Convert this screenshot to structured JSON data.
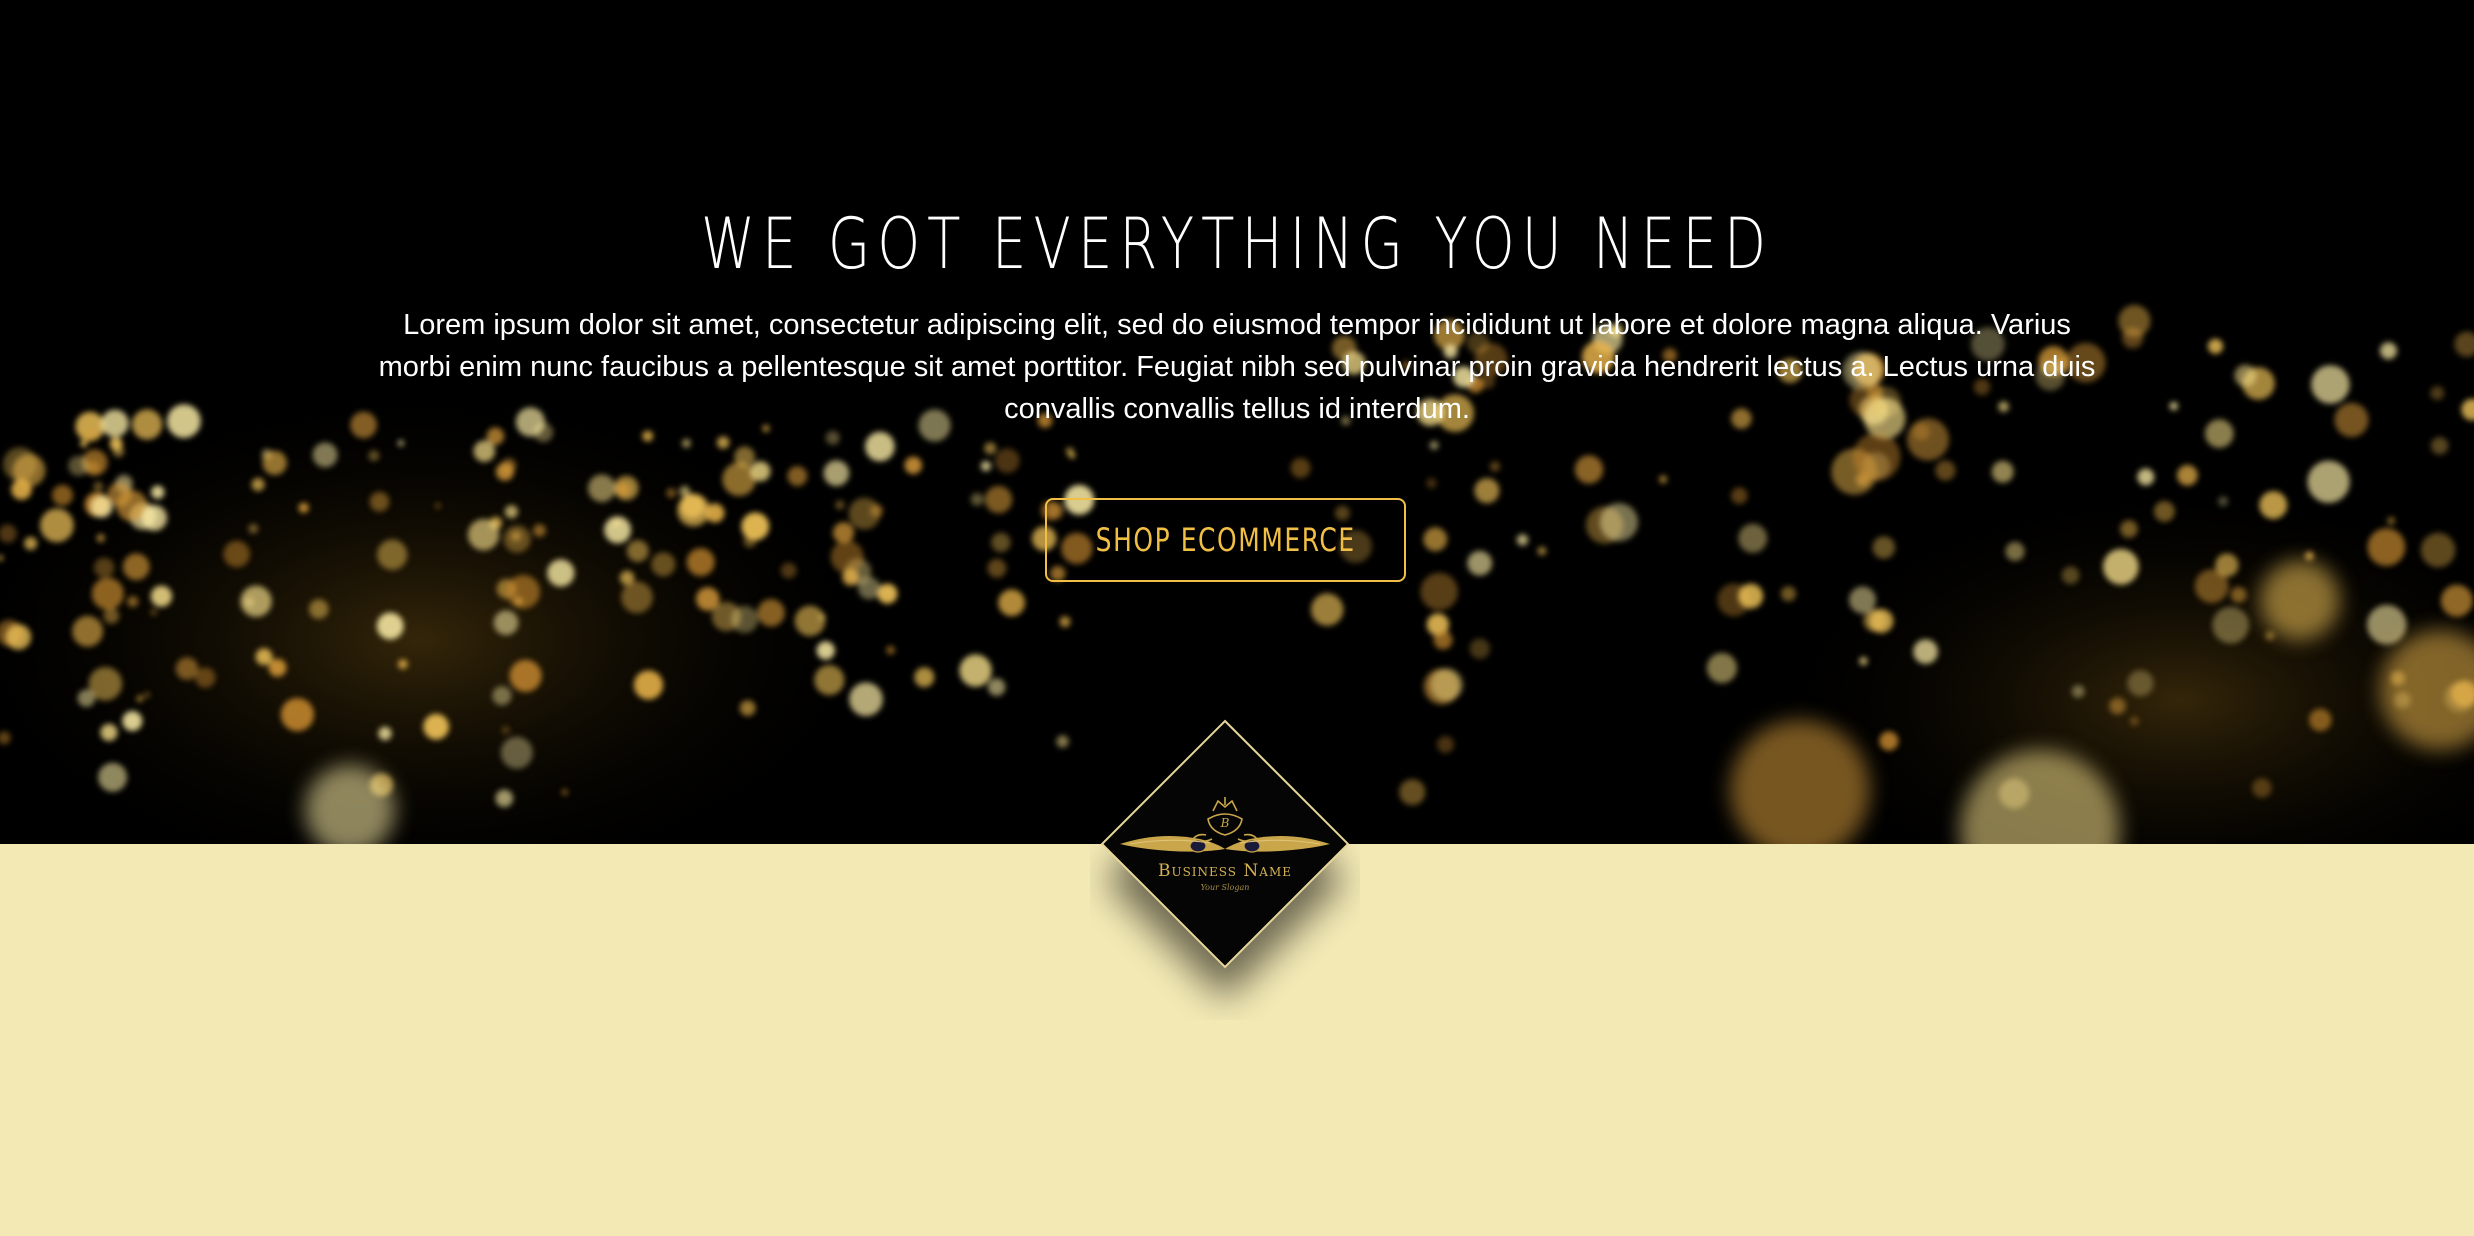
{
  "hero": {
    "title": "WE GOT EVERYTHING YOU NEED",
    "body": "Lorem ipsum dolor sit amet, consectetur adipiscing elit, sed do eiusmod tempor incididunt ut labore et dolore magna aliqua. Varius morbi enim nunc faucibus a pellentesque sit amet porttitor. Feugiat nibh sed pulvinar proin gravida hendrerit lectus a. Lectus urna duis convallis convallis tellus id interdum.",
    "button_label": "SHOP ECOMMERCE",
    "background": "bokeh-gold-lights"
  },
  "logo": {
    "name": "Business Name",
    "slogan": "Your Slogan",
    "icon": "crest-icon"
  },
  "colors": {
    "hero_background": "#000000",
    "accent_gold": "#f2bf45",
    "lower_background": "#f3e9b5",
    "logo_gold": "#d4b253"
  }
}
